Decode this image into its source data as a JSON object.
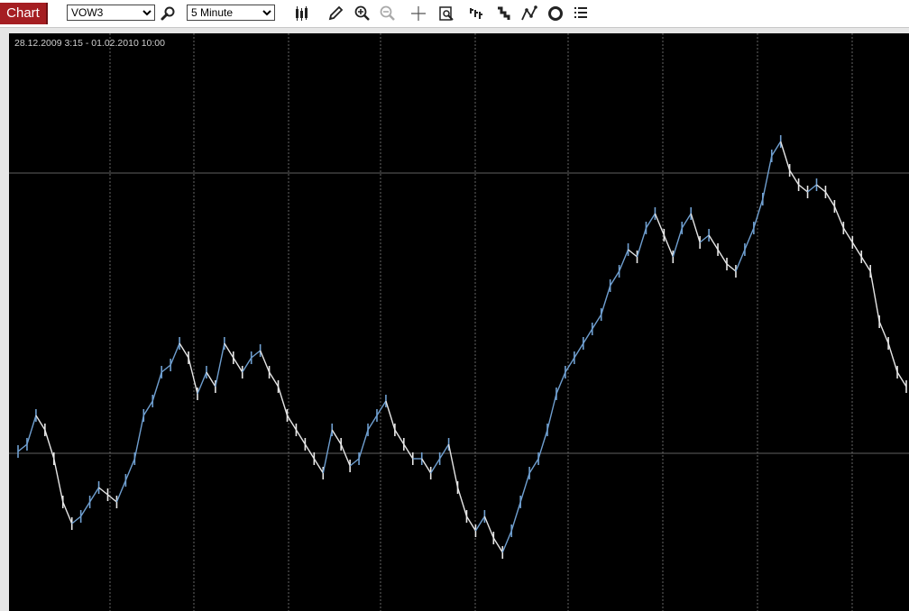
{
  "toolbar": {
    "tab_label": "Chart",
    "symbol_value": "VOW3",
    "interval_value": "5 Minute",
    "icons": [
      "search-icon",
      "candlestick-icon",
      "pencil-icon",
      "zoom-in-icon",
      "zoom-out-icon",
      "crosshair-icon",
      "magnify-page-icon",
      "bar-chart-icon",
      "step-chart-icon",
      "line-chart-icon",
      "circle-icon",
      "list-icon"
    ]
  },
  "chart": {
    "date_range": "28.12.2009 3:15 - 01.02.2010 10:00",
    "colors": {
      "background": "#000000",
      "up": "#6f9fd0",
      "down": "#e6e6e6",
      "grid": "#7f7f7f"
    }
  },
  "chart_data": {
    "type": "line",
    "title": "28.12.2009 3:15 - 01.02.2010 10:00",
    "xlabel": "",
    "ylabel": "",
    "grid": true,
    "series": [
      {
        "values": [
          67,
          68,
          72,
          70,
          66,
          60,
          57,
          58,
          60,
          62,
          61,
          60,
          63,
          66,
          72,
          74,
          78,
          79,
          82,
          80,
          75,
          78,
          76,
          82,
          80,
          78,
          80,
          81,
          78,
          76,
          72,
          70,
          68,
          66,
          64,
          70,
          68,
          65,
          66,
          70,
          72,
          74,
          70,
          68,
          66,
          66,
          64,
          66,
          68,
          62,
          58,
          56,
          58,
          55,
          53,
          56,
          60,
          64,
          66,
          70,
          75,
          78,
          80,
          82,
          84,
          86,
          90,
          92,
          95,
          94,
          98,
          100,
          97,
          94,
          98,
          100,
          96,
          97,
          95,
          93,
          92,
          95,
          98,
          102,
          108,
          110,
          106,
          104,
          103,
          104,
          103,
          101,
          98,
          96,
          94,
          92,
          85,
          82,
          78,
          76
        ]
      }
    ]
  }
}
